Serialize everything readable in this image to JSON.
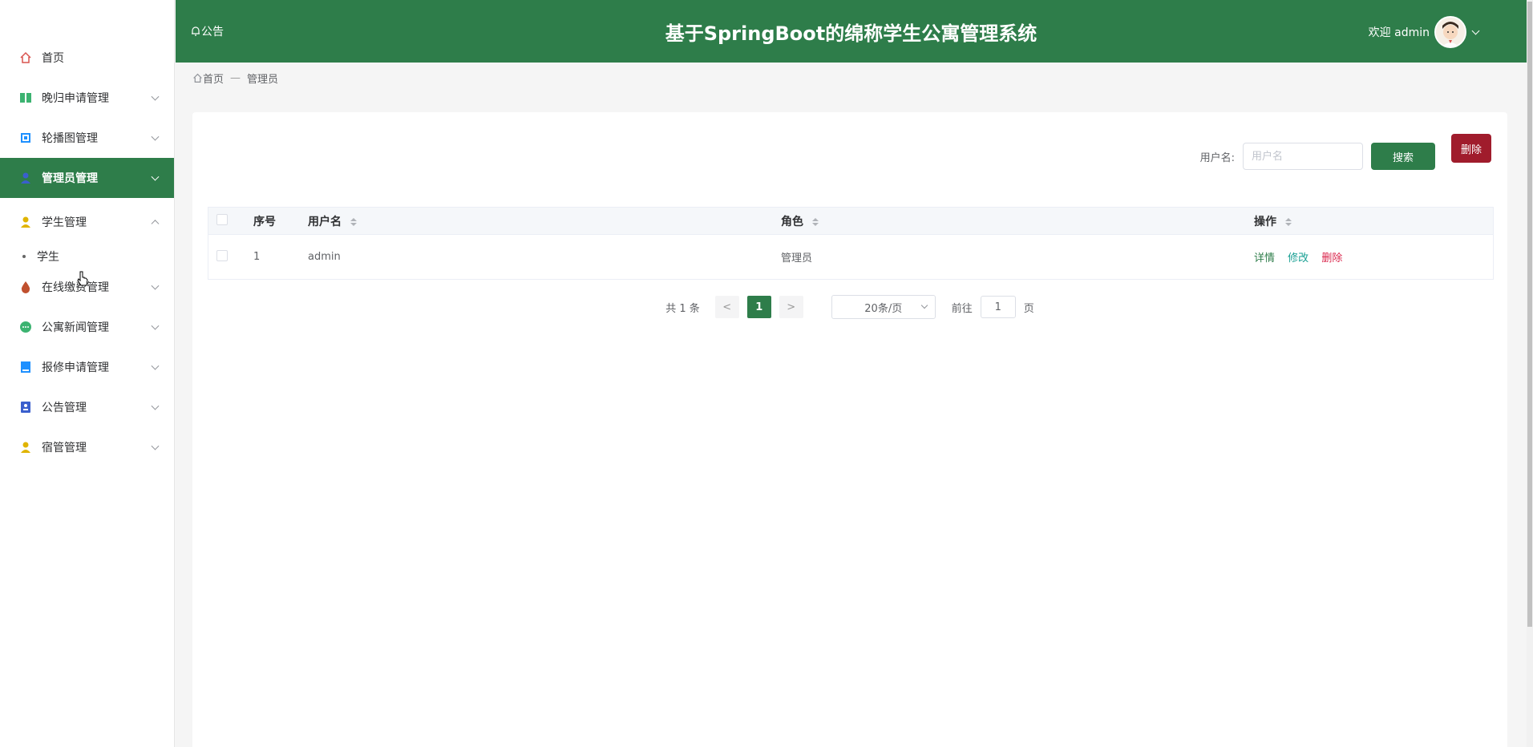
{
  "sidebar": {
    "items": [
      {
        "label": "首页",
        "icon": "home-icon",
        "color": "#d9534f"
      },
      {
        "label": "晚归申请管理",
        "icon": "book-icon",
        "color": "#3cb371"
      },
      {
        "label": "轮播图管理",
        "icon": "cpu-icon",
        "color": "#1e90ff"
      },
      {
        "label": "管理员管理",
        "icon": "user-icon",
        "color": "#3a5fcd"
      },
      {
        "label": "学生管理",
        "icon": "user-icon",
        "color": "#e0b400"
      },
      {
        "label": "在线缴费管理",
        "icon": "drop-icon",
        "color": "#c0502e"
      },
      {
        "label": "公寓新闻管理",
        "icon": "chat-icon",
        "color": "#3cb371"
      },
      {
        "label": "报修申请管理",
        "icon": "doc-icon",
        "color": "#1e90ff"
      },
      {
        "label": "公告管理",
        "icon": "card-icon",
        "color": "#3a5fcd"
      },
      {
        "label": "宿管管理",
        "icon": "user-icon",
        "color": "#e0b400"
      }
    ],
    "submenu_student": "学生"
  },
  "header": {
    "notice": "公告",
    "title": "基于SpringBoot的绵称学生公寓管理系统",
    "welcome": "欢迎 admin"
  },
  "breadcrumb": {
    "home": "首页",
    "sep": "—",
    "current": "管理员"
  },
  "search": {
    "label": "用户名:",
    "placeholder": "用户名",
    "search_button": "搜索",
    "delete_button": "删除"
  },
  "table": {
    "headers": [
      "序号",
      "用户名",
      "角色",
      "操作"
    ],
    "rows": [
      {
        "index": "1",
        "username": "admin",
        "role": "管理员"
      }
    ],
    "actions": {
      "detail": "详情",
      "edit": "修改",
      "delete": "删除"
    }
  },
  "pagination": {
    "total": "共 1 条",
    "prev": "<",
    "current_page": "1",
    "next": ">",
    "page_size": "20条/页",
    "goto_label": "前往",
    "goto_value": "1",
    "page_suffix": "页"
  },
  "colors": {
    "primary": "#2e7d4a",
    "danger": "#a01c2c"
  }
}
